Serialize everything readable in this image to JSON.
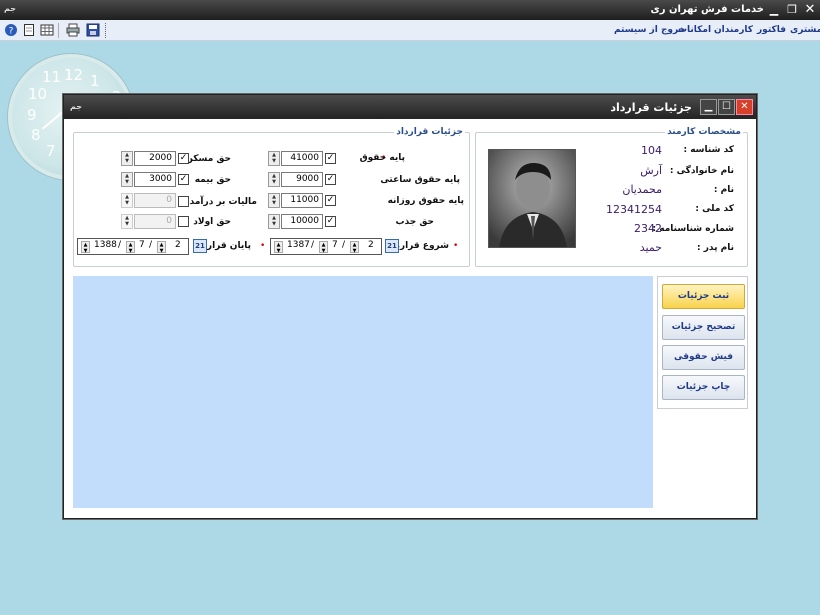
{
  "app": {
    "title": "خدمات فرش تهران ری",
    "icon_text": "جم"
  },
  "menu": [
    "مشتری",
    "فاکتور",
    "کارمندان",
    "امکانات",
    "خروج از سیستم"
  ],
  "toolbar": [
    "help-icon",
    "new-document-icon",
    "grid-icon",
    "print-icon",
    "save-icon"
  ],
  "clock": {
    "numbers": [
      "11",
      "12",
      "1",
      "10",
      "9",
      "8",
      "7",
      "2"
    ]
  },
  "dialog": {
    "title": "جزئیات قرارداد",
    "icon_text": "جم",
    "employee": {
      "group_title": "مشخصات کارمند",
      "fields": [
        {
          "label": "کد شناسه :",
          "value": "104"
        },
        {
          "label": "نام خانوادگی :",
          "value": "آرش"
        },
        {
          "label": "نام :",
          "value": "محمدیان"
        },
        {
          "label": "کد ملی :",
          "value": "12341254"
        },
        {
          "label": "شماره شناسنامه :",
          "value": "2342"
        },
        {
          "label": "نام پدر :",
          "value": "حمید"
        }
      ]
    },
    "contract": {
      "group_title": "جزئیات قرارداد",
      "right_col": [
        {
          "label": "پایه حقوق",
          "value": "41000",
          "checked": true,
          "required": true
        },
        {
          "label": "پایه حقوق ساعتی",
          "value": "9000",
          "checked": true
        },
        {
          "label": "پایه حقوق روزانه",
          "value": "11000",
          "checked": true
        },
        {
          "label": "حق جذب",
          "value": "10000",
          "checked": true
        }
      ],
      "left_col": [
        {
          "label": "حق مسکن",
          "value": "2000",
          "checked": true,
          "disabled": false
        },
        {
          "label": "حق بیمه",
          "value": "3000",
          "checked": true,
          "disabled": false
        },
        {
          "label": "مالیات بر درآمد",
          "value": "0",
          "checked": false,
          "disabled": true
        },
        {
          "label": "حق اولاد",
          "value": "0",
          "checked": false,
          "disabled": true
        }
      ],
      "start": {
        "label": "شروع قرارداد",
        "year": "1387",
        "month": "7",
        "day": "2",
        "cal": "21",
        "sep": "/"
      },
      "end": {
        "label": "پایان قرارداد",
        "year": "1388",
        "month": "7",
        "day": "2",
        "cal": "21",
        "sep": "/"
      }
    },
    "actions": [
      "ثبت جزئیات",
      "تصحیح جزئیات",
      "فیش حقوقی",
      "چاپ جزئیات"
    ],
    "required_mark": "•"
  }
}
